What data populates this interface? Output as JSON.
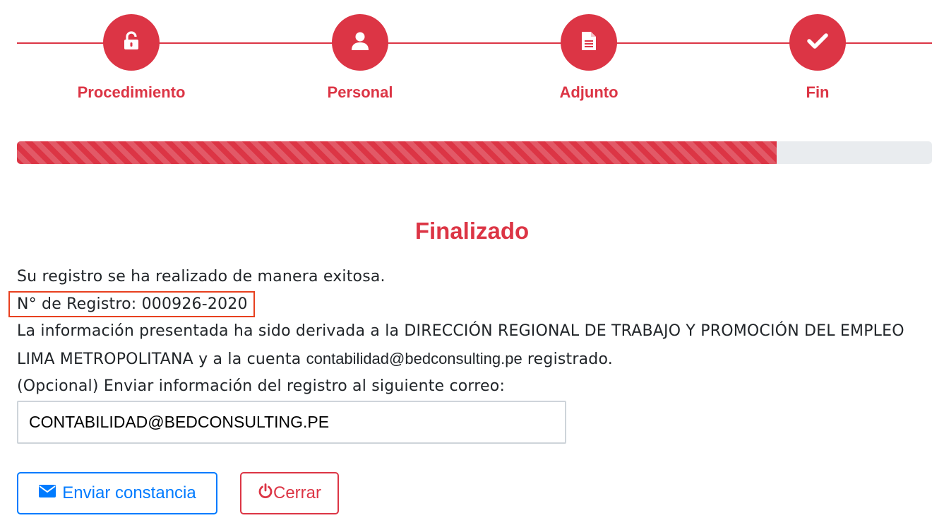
{
  "steps": [
    {
      "label": "Procedimiento",
      "icon": "unlock-icon"
    },
    {
      "label": "Personal",
      "icon": "user-icon"
    },
    {
      "label": "Adjunto",
      "icon": "file-icon"
    },
    {
      "label": "Fin",
      "icon": "check-icon"
    }
  ],
  "progress": {
    "percent": 83
  },
  "result": {
    "title": "Finalizado",
    "line1": "Su registro se ha realizado de manera exitosa.",
    "registro_label": "N° de Registro: 000926-2020",
    "line3_part1": "La información presentada ha sido derivada a la DIRECCIÓN REGIONAL DE TRABAJO Y PROMOCIÓN DEL EMPLEO LIMA METROPOLITANA y a la cuenta",
    "account_email": "contabilidad@bedconsulting.pe",
    "line3_part2": "registrado.",
    "optional_label": "(Opcional) Enviar información del registro al siguiente correo:"
  },
  "email_input": {
    "value": "CONTABILIDAD@BEDCONSULTING.PE"
  },
  "buttons": {
    "send_label": "Enviar constancia",
    "close_label": "Cerrar"
  },
  "colors": {
    "accent": "#dc3545",
    "primary": "#007bff",
    "highlight_box": "#e8401f"
  }
}
